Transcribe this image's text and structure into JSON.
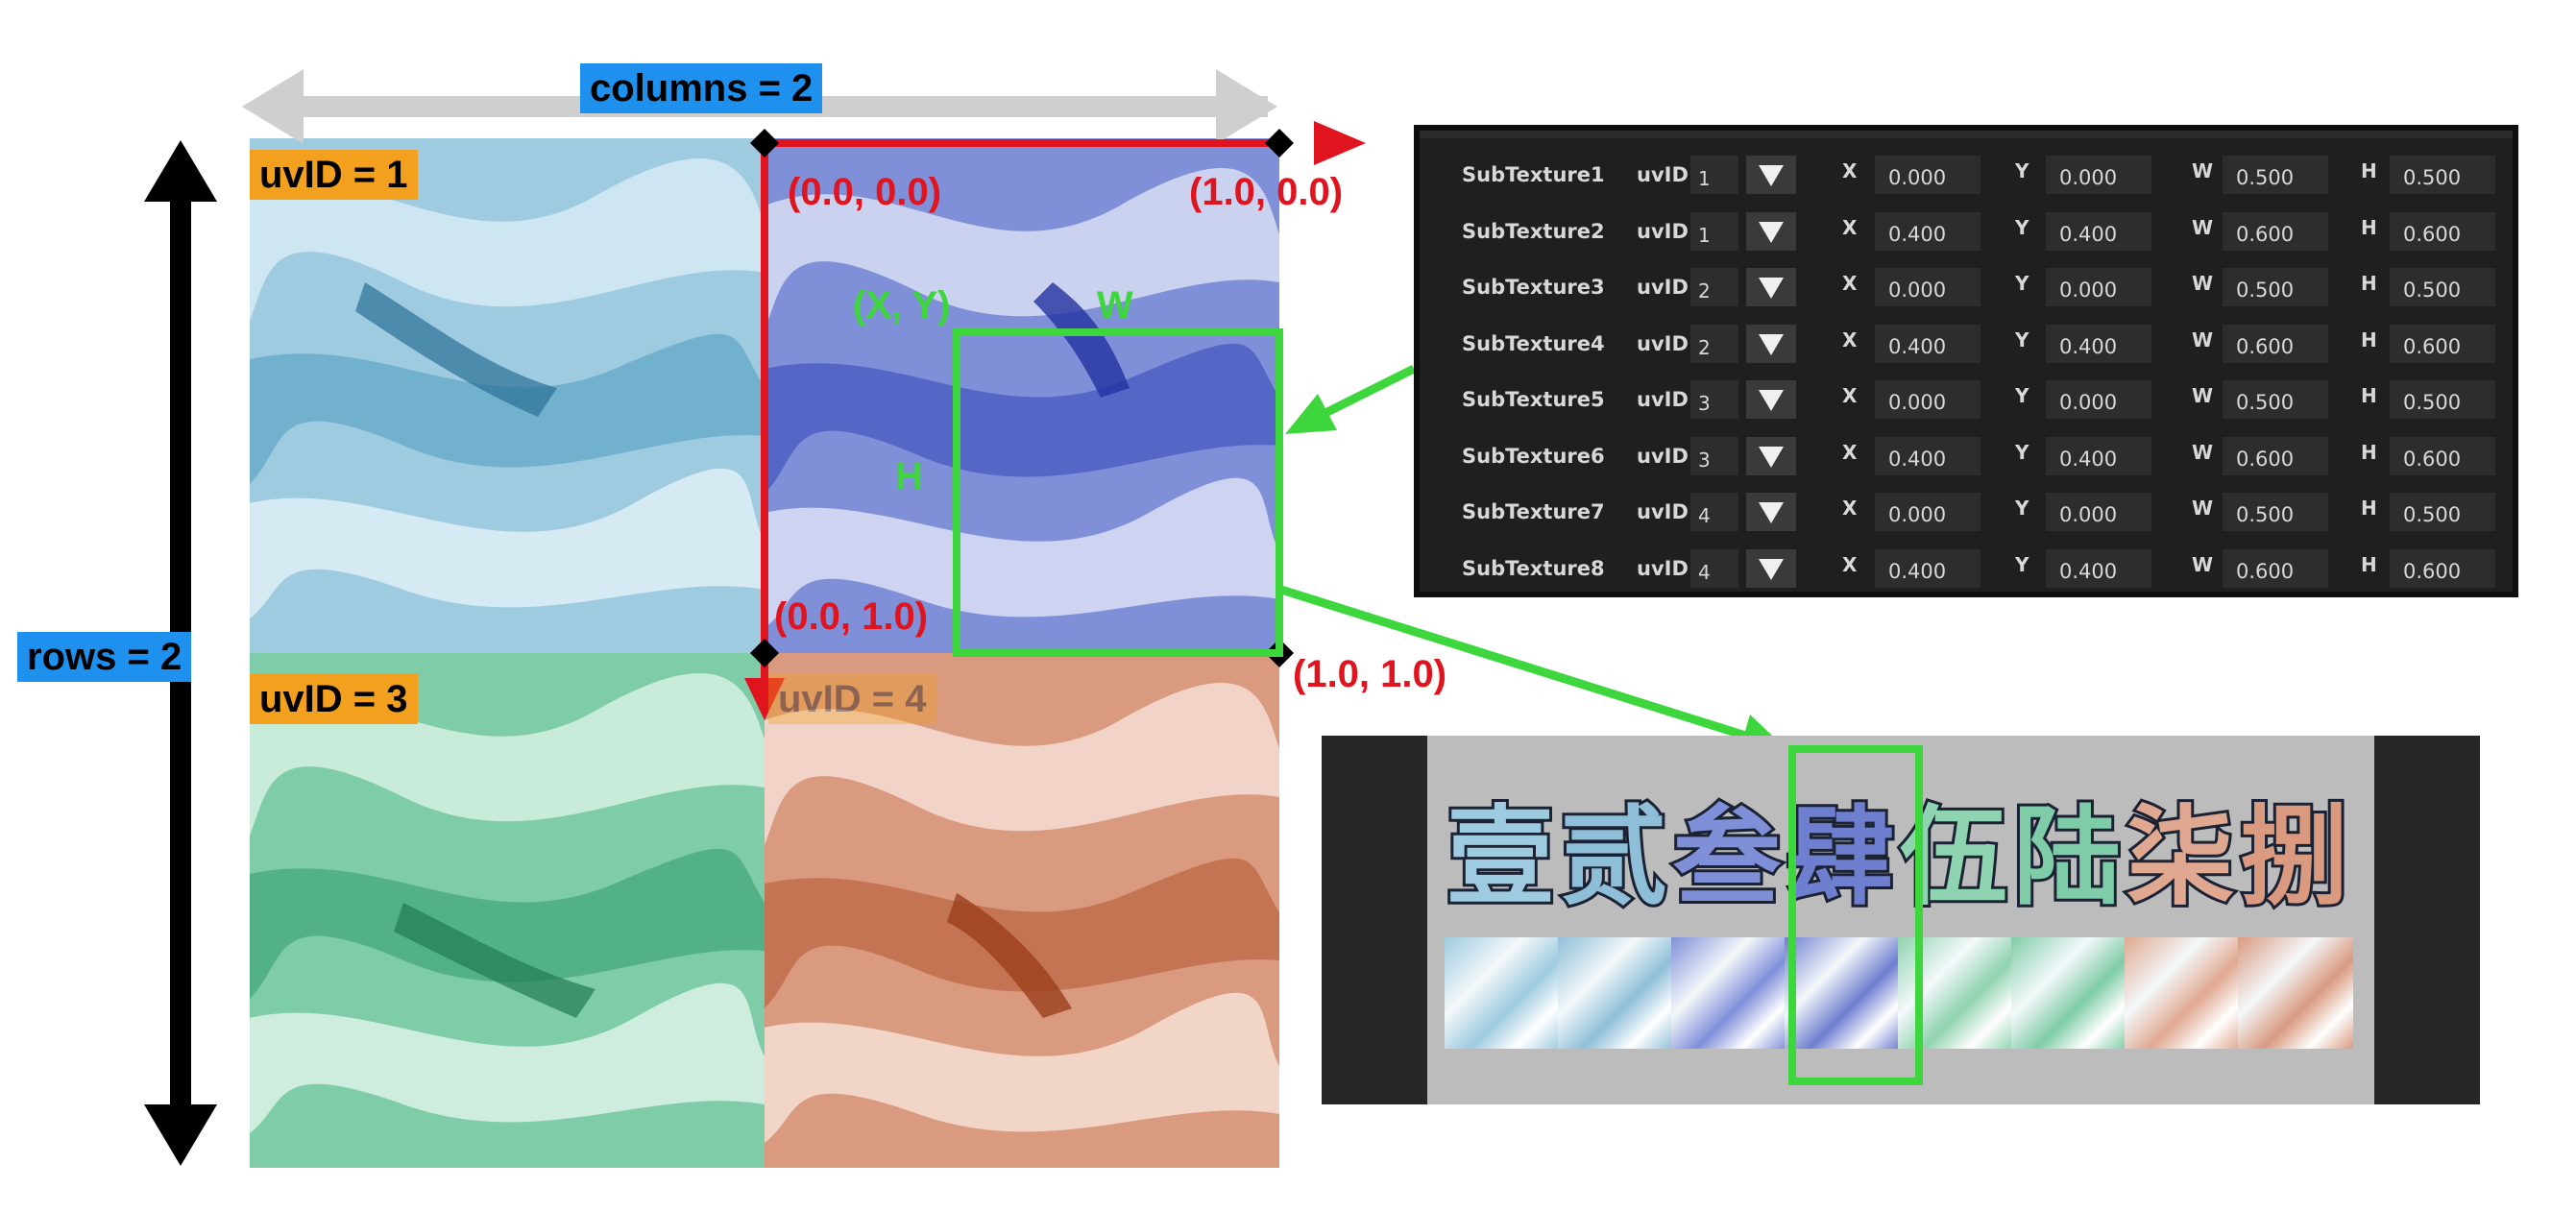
{
  "labels": {
    "columns": "columns = 2",
    "rows": "rows = 2",
    "uvid1": "uvID = 1",
    "uvid3": "uvID = 3",
    "uvid4": "uvID = 4",
    "coord_tl": "(0.0, 0.0)",
    "coord_tr": "(1.0, 0.0)",
    "coord_bl": "(0.0, 1.0)",
    "coord_br": "(1.0, 1.0)",
    "xy": "(X, Y)",
    "w": "W",
    "h": "H"
  },
  "panel": {
    "uv_label": "uvID",
    "x_label": "X",
    "y_label": "Y",
    "w_label": "W",
    "h_label": "H",
    "rows": [
      {
        "name": "SubTexture1",
        "uv": "1",
        "x": "0.000",
        "y": "0.000",
        "w": "0.500",
        "h": "0.500"
      },
      {
        "name": "SubTexture2",
        "uv": "1",
        "x": "0.400",
        "y": "0.400",
        "w": "0.600",
        "h": "0.600"
      },
      {
        "name": "SubTexture3",
        "uv": "2",
        "x": "0.000",
        "y": "0.000",
        "w": "0.500",
        "h": "0.500"
      },
      {
        "name": "SubTexture4",
        "uv": "2",
        "x": "0.400",
        "y": "0.400",
        "w": "0.600",
        "h": "0.600"
      },
      {
        "name": "SubTexture5",
        "uv": "3",
        "x": "0.000",
        "y": "0.000",
        "w": "0.500",
        "h": "0.500"
      },
      {
        "name": "SubTexture6",
        "uv": "3",
        "x": "0.400",
        "y": "0.400",
        "w": "0.600",
        "h": "0.600"
      },
      {
        "name": "SubTexture7",
        "uv": "4",
        "x": "0.000",
        "y": "0.000",
        "w": "0.500",
        "h": "0.500"
      },
      {
        "name": "SubTexture8",
        "uv": "4",
        "x": "0.400",
        "y": "0.400",
        "w": "0.600",
        "h": "0.600"
      }
    ]
  },
  "preview": {
    "glyphs": [
      "壹",
      "贰",
      "叁",
      "肆",
      "伍",
      "陆",
      "柒",
      "捌"
    ]
  },
  "colors": {
    "accent_red": "#e0141e",
    "accent_green": "#3dd63d",
    "badge_blue": "#1e90ee",
    "badge_orange": "#f2a01e"
  }
}
